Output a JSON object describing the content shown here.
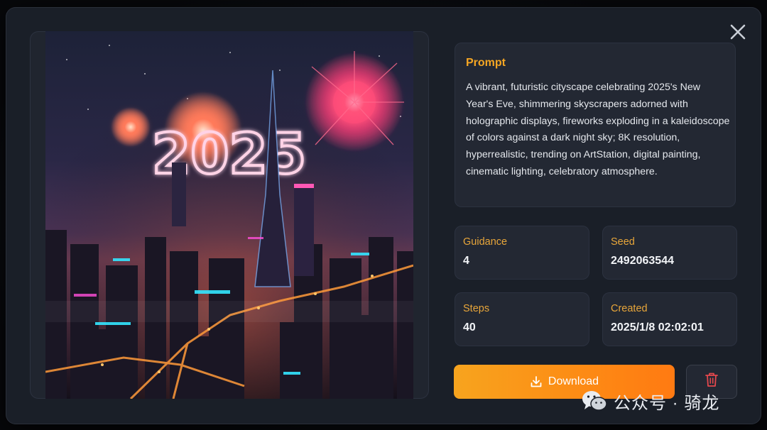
{
  "prompt": {
    "title": "Prompt",
    "text": "A vibrant, futuristic cityscape celebrating 2025's New Year's Eve, shimmering skyscrapers adorned with holographic displays, fireworks exploding in a kaleidoscope of colors against a dark night sky; 8K resolution, hyperrealistic, trending on ArtStation, digital painting, cinematic lighting, celebratory atmosphere."
  },
  "meta": {
    "guidance": {
      "label": "Guidance",
      "value": "4"
    },
    "seed": {
      "label": "Seed",
      "value": "2492063544"
    },
    "steps": {
      "label": "Steps",
      "value": "40"
    },
    "created": {
      "label": "Created",
      "value": "2025/1/8 02:02:01"
    }
  },
  "actions": {
    "download_label": "Download",
    "download_icon": "download-icon",
    "delete_icon": "trash-icon",
    "close_icon": "close-icon"
  },
  "image": {
    "overlay_text": "2025"
  },
  "watermark": {
    "text": "公众号 · 骑龙",
    "icon": "wechat-icon"
  },
  "colors": {
    "accent": "#f5a623",
    "download_gradient_start": "#f7a41e",
    "download_gradient_end": "#ff7a12",
    "delete_icon": "#e5484d",
    "card_bg": "#232833",
    "modal_bg": "#1a1f28"
  }
}
